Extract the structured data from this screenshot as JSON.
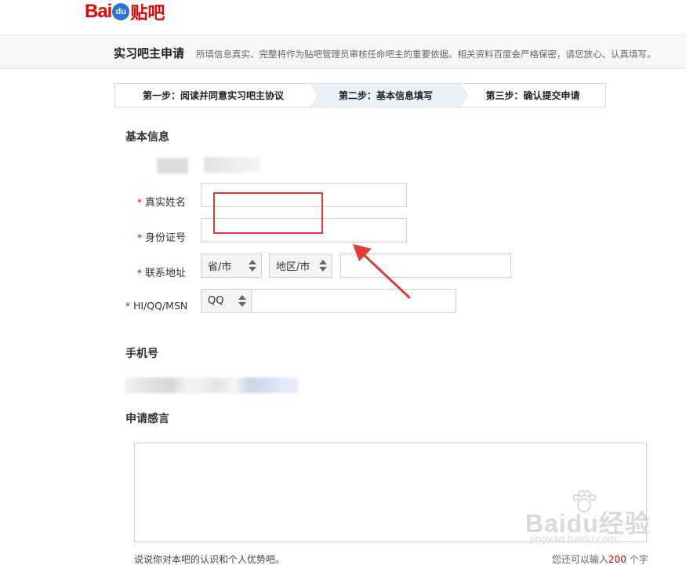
{
  "brand": {
    "logo_latin": "Bai",
    "logo_paw": "du",
    "logo_cn": "贴吧"
  },
  "header": {
    "title": "实习吧主申请",
    "description": "所填信息真实、完整将作为贴吧管理员审核任命吧主的重要依据。相关资料百度会严格保密，请您放心、认真填写。"
  },
  "steps": [
    {
      "label": "第一步：阅读并同意实习吧主协议",
      "active": false
    },
    {
      "label": "第二步：基本信息填写",
      "active": true
    },
    {
      "label": "第三步：确认提交申请",
      "active": false
    }
  ],
  "basic_info": {
    "section_title": "基本信息",
    "fields": {
      "real_name": {
        "required_mark": "*",
        "label": "真实姓名",
        "value": ""
      },
      "id_number": {
        "required_mark": "*",
        "label": "身份证号",
        "value": ""
      },
      "address": {
        "required_mark": "*",
        "label": "联系地址",
        "province_selected": "省/市",
        "region_selected": "地区/市",
        "detail_value": ""
      },
      "im": {
        "required_mark": "*",
        "label": "HI/QQ/MSN",
        "type_selected": "QQ",
        "value": ""
      }
    }
  },
  "phone": {
    "section_title": "手机号"
  },
  "statement": {
    "section_title": "申请感言",
    "value": "",
    "hint": "说说你对本吧的认识和个人优势吧。",
    "remaining_prefix": "您还可以输入",
    "remaining_count": "200",
    "remaining_suffix": " 个字"
  },
  "annotation": {
    "box_color": "#e03b3b",
    "arrow_color": "#e03b3b"
  },
  "watermark": {
    "text": "Baidu经验",
    "url": "jingyan.baidu.com"
  },
  "colors": {
    "brand_red": "#e10602",
    "active_step_bg": "#e9f1fb",
    "required_star": "#cc0000"
  }
}
